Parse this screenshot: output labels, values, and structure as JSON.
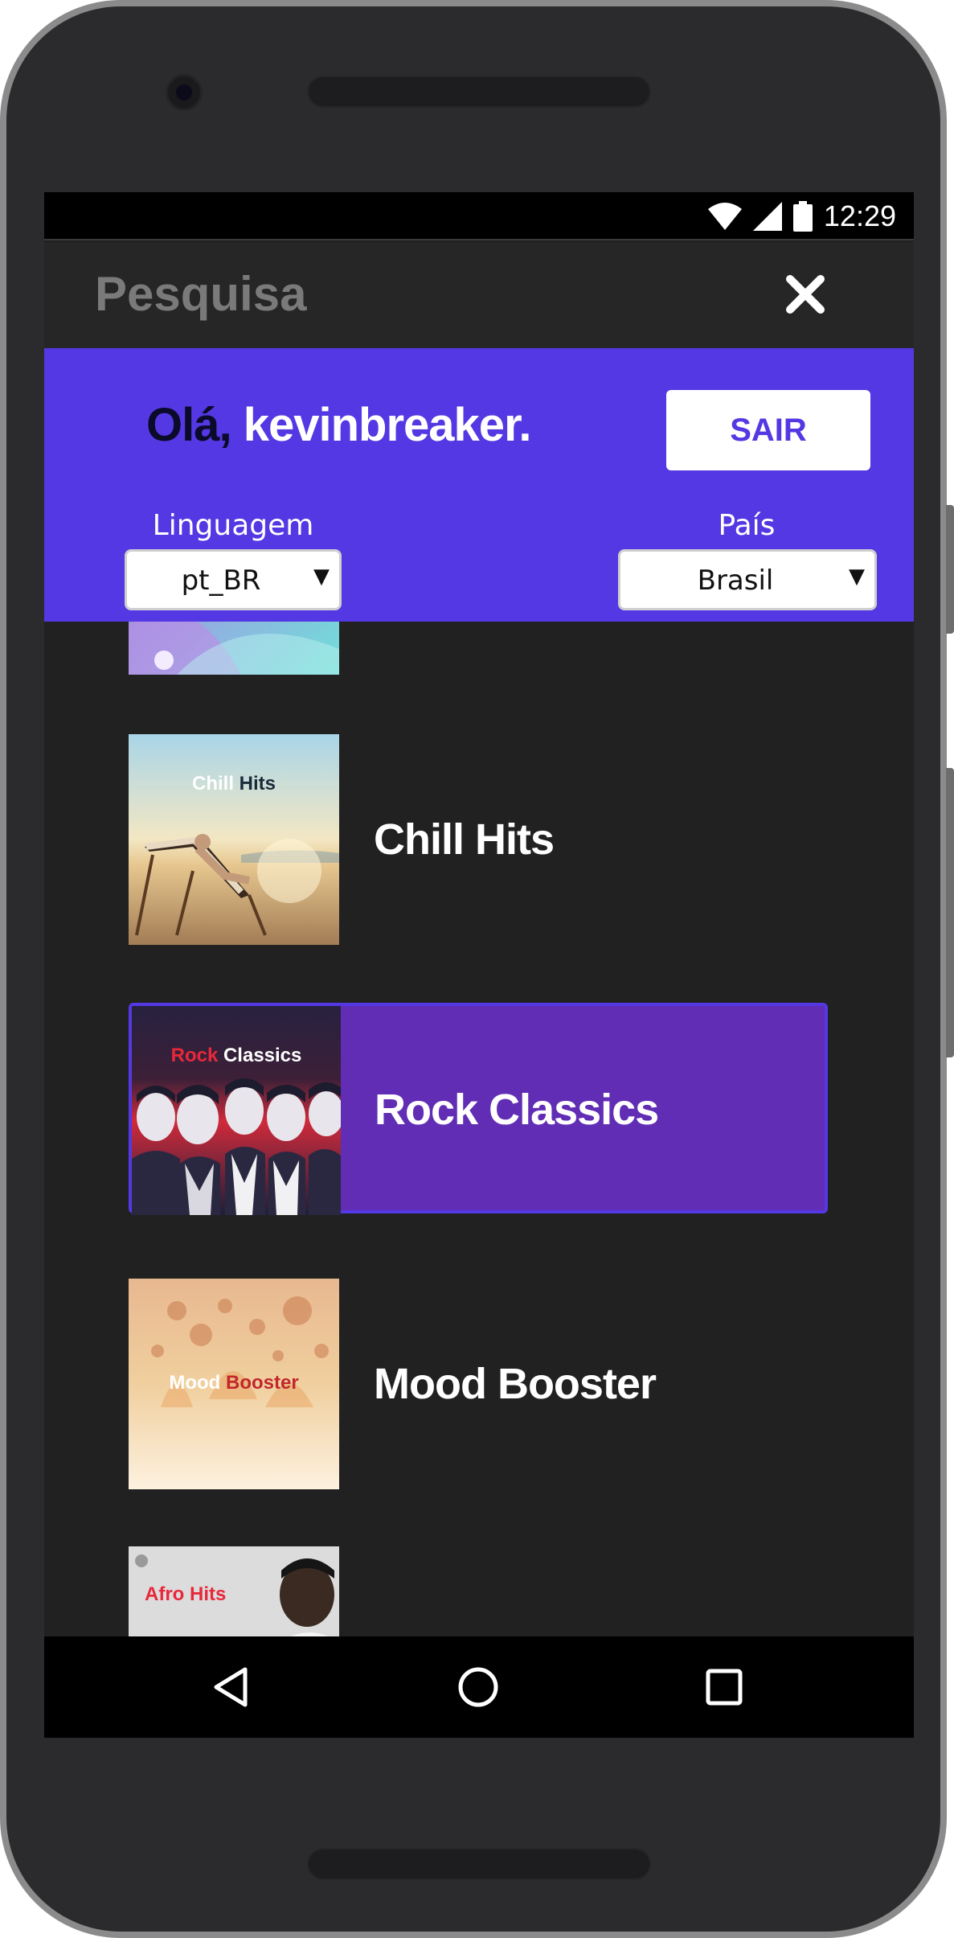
{
  "status_bar": {
    "time": "12:29",
    "icons": [
      "wifi-icon",
      "cell-signal-icon",
      "battery-icon"
    ]
  },
  "header": {
    "title": "Pesquisa",
    "close_icon": "close-icon"
  },
  "user": {
    "greeting_prefix": "Olá,",
    "greeting_name": " kevinbreaker.",
    "logout_label": "SAIR",
    "language_label": "Linguagem",
    "language_value": "pt_BR",
    "country_label": "País",
    "country_value": "Brasil"
  },
  "playlists": [
    {
      "name": "",
      "cover_text": ""
    },
    {
      "name": "Chill Hits",
      "cover_text_a": "Chill",
      "cover_text_b": "Hits"
    },
    {
      "name": "Rock Classics",
      "cover_text_a": "Rock",
      "cover_text_b": "Classics",
      "selected": true
    },
    {
      "name": "Mood Booster",
      "cover_text_a": "Mood",
      "cover_text_b": "Booster"
    },
    {
      "name": "",
      "cover_text_a": "Afro Hits"
    }
  ],
  "nav": {
    "back_icon": "back-triangle-icon",
    "home_icon": "home-circle-icon",
    "recents_icon": "recents-square-icon"
  },
  "colors": {
    "accent": "#5438e3",
    "selected_item": "#612db5",
    "background": "#212121"
  }
}
